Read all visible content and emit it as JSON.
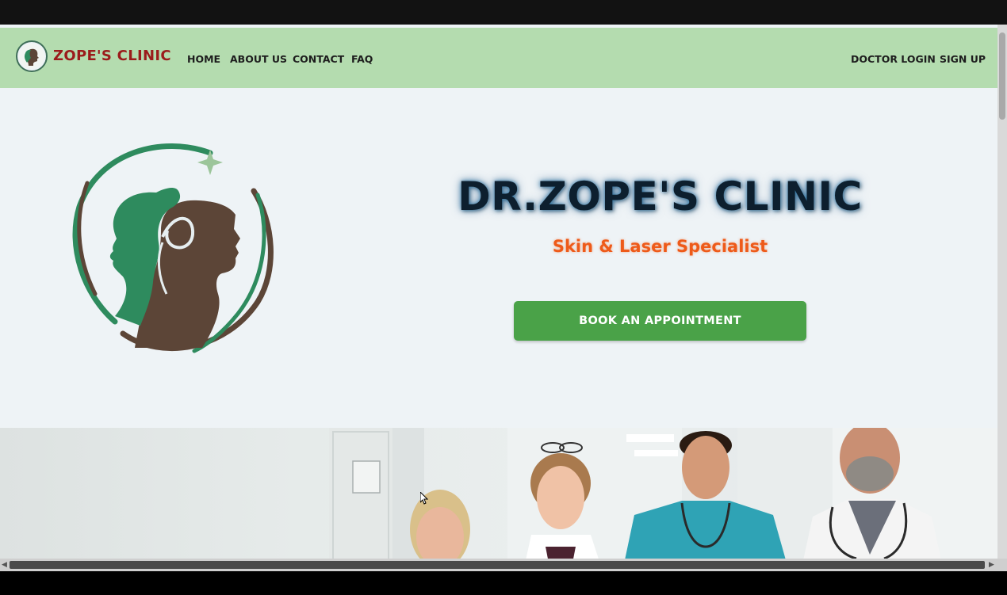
{
  "navbar": {
    "brand": "ZOPE'S CLINIC",
    "links": [
      "HOME",
      "ABOUT US",
      "CONTACT",
      "FAQ"
    ],
    "right_links": [
      "DOCTOR LOGIN",
      "SIGN UP"
    ]
  },
  "hero": {
    "title": "DR.ZOPE'S CLINIC",
    "subtitle": "Skin & Laser Specialist",
    "cta_label": "BOOK AN APPOINTMENT"
  },
  "colors": {
    "navbar_bg": "#b4dcaf",
    "brand_text": "#9b1b1b",
    "cta_bg": "#4aa248",
    "subtitle": "#ee5a19",
    "logo_green": "#2e8b5e",
    "logo_brown": "#5c4537"
  },
  "icons": [
    "clinic-logo-icon",
    "hero-logo-icon",
    "doctors-photo"
  ]
}
